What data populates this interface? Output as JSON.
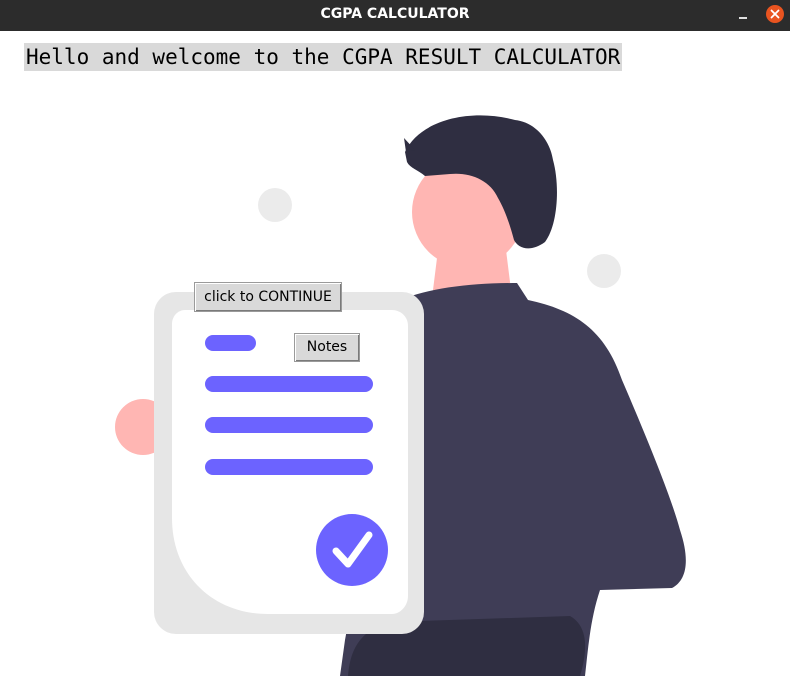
{
  "window": {
    "title": "CGPA CALCULATOR"
  },
  "main": {
    "welcome_text": "Hello and welcome to the CGPA RESULT CALCULATOR",
    "continue_label": "click to CONTINUE",
    "notes_label": "Notes"
  },
  "colors": {
    "titlebar": "#2c2c2c",
    "close_button": "#e95420",
    "accent_purple": "#6c63ff",
    "shirt": "#3f3d56",
    "hair": "#2f2e41",
    "skin": "#ffb6b3",
    "clipboard": "#e6e6e6"
  },
  "icons": {
    "minimize": "minimize-icon",
    "close": "close-icon",
    "check": "checkmark-icon"
  }
}
